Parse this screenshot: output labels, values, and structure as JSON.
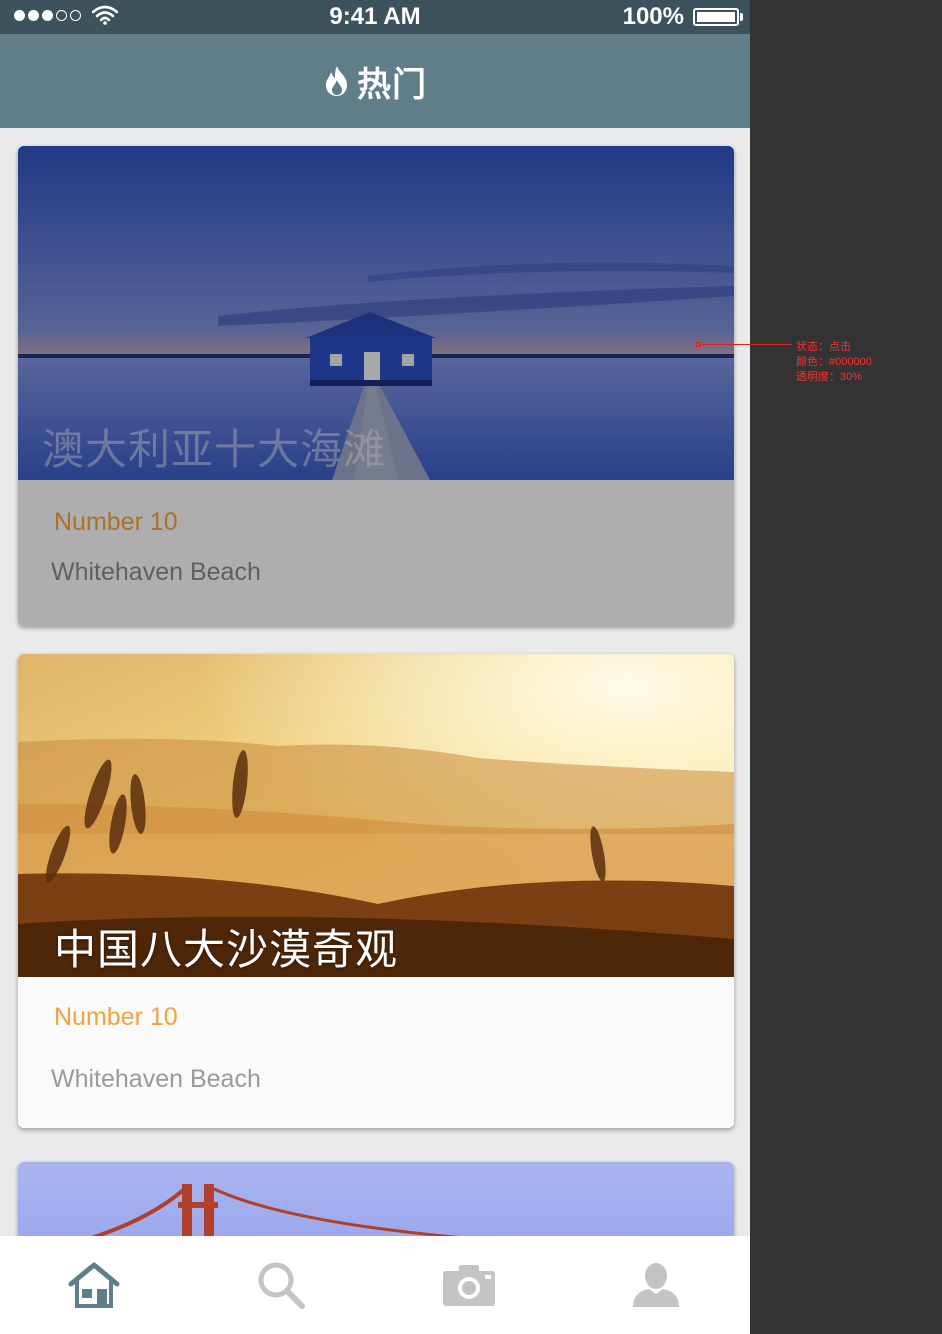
{
  "status_bar": {
    "signal": "●●●○○",
    "wifi_icon": "wifi-icon",
    "time": "9:41 AM",
    "battery_percent": "100%",
    "battery_level": 1.0
  },
  "nav": {
    "icon": "flame-icon",
    "title": "热门"
  },
  "cards": [
    {
      "title": "澳大利亚十大海滩",
      "number": "Number 10",
      "place": "Whitehaven Beach",
      "state": "pressed"
    },
    {
      "title": "中国八大沙漠奇观",
      "number": "Number 10",
      "place": "Whitehaven Beach"
    },
    {
      "title": "",
      "number": "",
      "place": ""
    }
  ],
  "tabs": [
    {
      "icon": "home-icon",
      "active": true
    },
    {
      "icon": "search-icon",
      "active": false
    },
    {
      "icon": "camera-icon",
      "active": false
    },
    {
      "icon": "profile-icon",
      "active": false
    }
  ],
  "annotation": {
    "lines": [
      "状态：点击",
      "颜色：#000000",
      "透明度：30%"
    ]
  },
  "colors": {
    "status_bar": "#3e525c",
    "nav_bar": "#5f7e89",
    "accent": "#f4a23b",
    "tab_active": "#5f7e89",
    "tab_inactive": "#c4c4c4",
    "page_bg": "#eaeaea",
    "annotation": "#ff3030"
  }
}
